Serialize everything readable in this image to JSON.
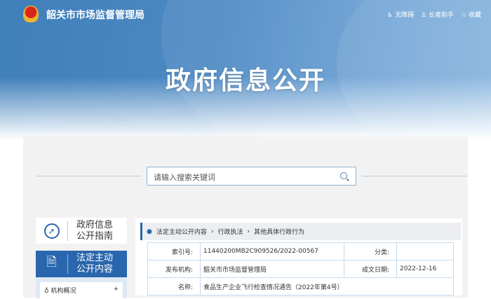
{
  "header": {
    "site_title": "韶关市市场监督管理局",
    "tools": [
      "无障碍",
      "长者助手",
      "收藏"
    ],
    "banner_title": "政府信息公开"
  },
  "search": {
    "placeholder": "请输入搜索关键词"
  },
  "sidebar": {
    "guide": [
      "政府信息",
      "公开指南"
    ],
    "active": [
      "法定主动",
      "公开内容"
    ],
    "sub_items": [
      {
        "label": "机构概况",
        "toggle": "+"
      }
    ]
  },
  "breadcrumb": [
    "法定主动公开内容",
    "行政执法",
    "其他具体行政行为"
  ],
  "meta": {
    "index_label": "索引号:",
    "index_value": "11440200MB2C909526/2022-00567",
    "category_label": "分类:",
    "category_value": "",
    "publisher_label": "发布机构:",
    "publisher_value": "韶关市市场监督管理局",
    "date_label": "成文日期:",
    "date_value": "2022-12-16",
    "name_label": "名称:",
    "name_value": "食品生产企业飞行检查情况通告（2022年第4号）"
  }
}
